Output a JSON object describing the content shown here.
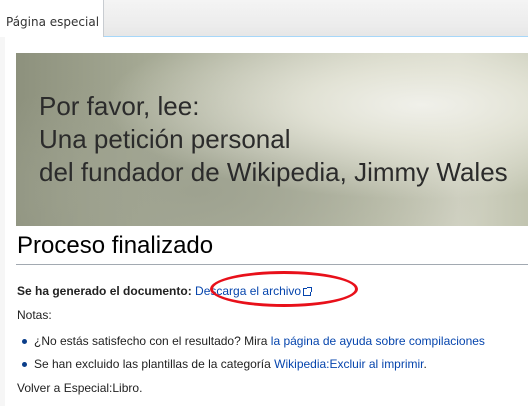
{
  "tab": {
    "label": "Página especial"
  },
  "banner": {
    "line1": "Por favor, lee:",
    "line2": "Una petición personal",
    "line3": "del fundador de Wikipedia, Jimmy Wales"
  },
  "main": {
    "heading": "Proceso finalizado",
    "generated_label": "Se ha generado el documento:",
    "download_link": "Descarga el archivo",
    "notes_label": "Notas:",
    "bullet1_prefix": "¿No estás satisfecho con el resultado? Mira ",
    "bullet1_link": "la página de ayuda sobre compilaciones",
    "bullet2_prefix": "Se han excluido las plantillas de la categoría ",
    "bullet2_link": "Wikipedia:Excluir al imprimir",
    "bullet2_suffix": ".",
    "back_text": "Volver a Especial:Libro."
  },
  "colors": {
    "link": "#0645ad",
    "annotation_ellipse": "#e8101a",
    "tab_border": "#a7d7f9"
  },
  "icons": {
    "external_link": "external-link-icon"
  }
}
